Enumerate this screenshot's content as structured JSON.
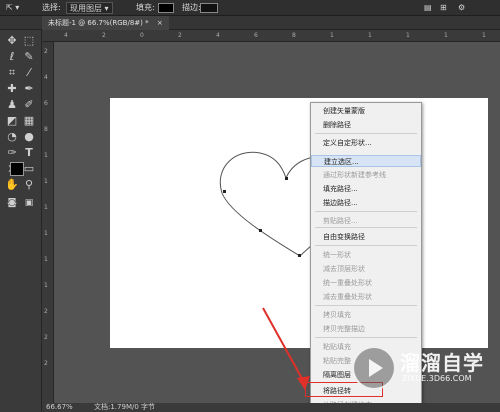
{
  "options_bar": {
    "select_label": "选择:",
    "select_value": "现用图层",
    "fill_label": "填充:",
    "stroke_label": "描边:"
  },
  "tab": {
    "title": "未标题-1 @ 66.7%(RGB/8#) *",
    "close": "×"
  },
  "rulers": {
    "top": [
      "4",
      "2",
      "0",
      "2",
      "4",
      "6",
      "8",
      "1",
      "1",
      "1",
      "1",
      "1"
    ],
    "left": [
      "2",
      "4",
      "6",
      "8",
      "1",
      "1",
      "1",
      "1",
      "1",
      "1",
      "2",
      "2",
      "2"
    ]
  },
  "context_menu": {
    "items": [
      {
        "label": "创建矢量蒙版",
        "enabled": true
      },
      {
        "label": "删除路径",
        "enabled": true
      },
      {
        "label": "定义自定形状...",
        "enabled": true
      },
      {
        "label": "建立选区...",
        "enabled": true,
        "highlighted": true
      },
      {
        "label": "通过形状新建参考线",
        "enabled": false
      },
      {
        "label": "填充路径...",
        "enabled": true
      },
      {
        "label": "描边路径...",
        "enabled": true
      },
      {
        "label": "剪贴路径...",
        "enabled": false
      },
      {
        "label": "自由变换路径",
        "enabled": true
      },
      {
        "label": "统一形状",
        "enabled": false
      },
      {
        "label": "减去顶层形状",
        "enabled": false
      },
      {
        "label": "统一重叠处形状",
        "enabled": false
      },
      {
        "label": "减去重叠处形状",
        "enabled": false
      },
      {
        "label": "拷贝填充",
        "enabled": false
      },
      {
        "label": "拷贝完整描边",
        "enabled": false
      },
      {
        "label": "粘贴填充",
        "enabled": false
      },
      {
        "label": "粘贴完整",
        "enabled": false
      },
      {
        "label": "隔离图层",
        "enabled": true
      },
      {
        "label": "将路径转",
        "enabled": true
      },
      {
        "label": "从路径创建约束",
        "enabled": false
      }
    ]
  },
  "watermark": {
    "title": "溜溜自学",
    "url": "ZIXUE.3D66.COM"
  },
  "status_bar": {
    "zoom": "66.67%",
    "doc_info": "文档:1.79M/0 字节"
  },
  "colors": {
    "accent_red": "#e0302a",
    "menu_highlight": "#d6e4f5"
  }
}
